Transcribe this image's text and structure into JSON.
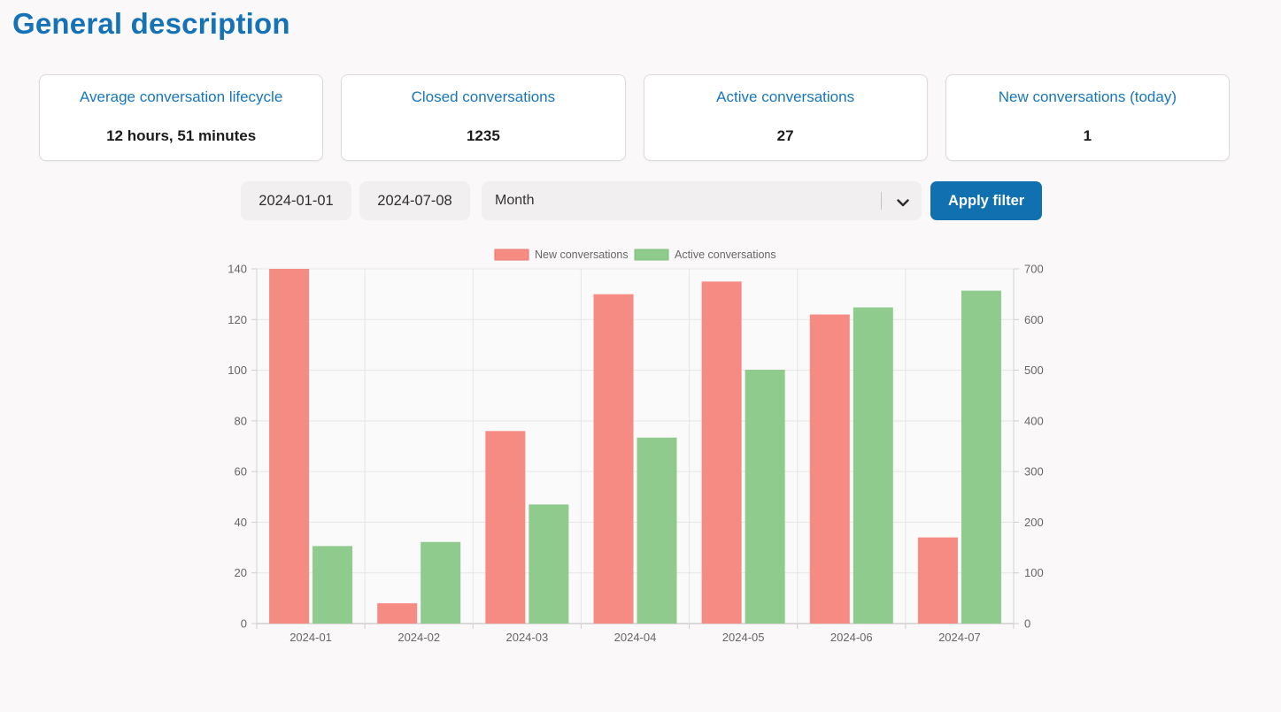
{
  "page": {
    "title": "General description"
  },
  "cards": [
    {
      "title": "Average conversation lifecycle",
      "value": "12 hours, 51 minutes"
    },
    {
      "title": "Closed conversations",
      "value": "1235"
    },
    {
      "title": "Active conversations",
      "value": "27"
    },
    {
      "title": "New conversations (today)",
      "value": "1"
    }
  ],
  "filters": {
    "start_date": "2024-01-01",
    "end_date": "2024-07-08",
    "group_by_selected": "Month",
    "apply_label": "Apply filter"
  },
  "colors": {
    "heading_blue": "#1572b6",
    "card_title_blue": "#1876bb",
    "button_blue": "#1170b0",
    "bar_red": "#f58b82",
    "bar_green": "#90cb8e",
    "axis_text": "#666666",
    "grid_line": "#e6e6e6",
    "page_background": "#faf8f8"
  },
  "chart_data": {
    "type": "bar",
    "title": "",
    "categories": [
      "2024-01",
      "2024-02",
      "2024-03",
      "2024-04",
      "2024-05",
      "2024-06",
      "2024-07"
    ],
    "series": [
      {
        "name": "New conversations",
        "axis": "left",
        "color": "#f58b82",
        "border_color": "#f0766c",
        "values": [
          140,
          8,
          76,
          130,
          135,
          122,
          34
        ]
      },
      {
        "name": "Active conversations",
        "axis": "right",
        "color": "#90cb8e",
        "border_color": "#7cbe7a",
        "values": [
          153,
          161,
          235,
          367,
          501,
          624,
          657
        ]
      }
    ],
    "left_axis": {
      "min": 0,
      "max": 140,
      "step": 20
    },
    "right_axis": {
      "min": 0,
      "max": 700,
      "step": 100
    },
    "legend_position": "top",
    "grid": true
  }
}
